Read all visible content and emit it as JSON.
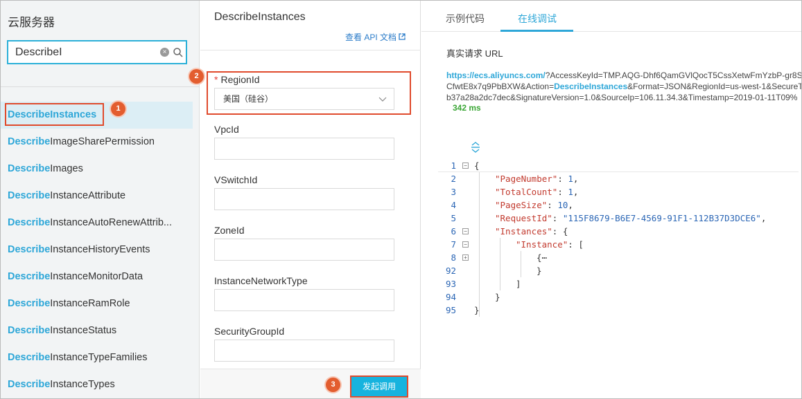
{
  "left": {
    "title": "云服务器",
    "search": {
      "value": "DescribeI",
      "placeholder": ""
    },
    "highlight_prefix": "Describe",
    "items": [
      {
        "prefix": "Describe",
        "rest": "Instances"
      },
      {
        "prefix": "Describe",
        "rest": "ImageSharePermission"
      },
      {
        "prefix": "Describe",
        "rest": "Images"
      },
      {
        "prefix": "Describe",
        "rest": "InstanceAttribute"
      },
      {
        "prefix": "Describe",
        "rest": "InstanceAutoRenewAttrib..."
      },
      {
        "prefix": "Describe",
        "rest": "InstanceHistoryEvents"
      },
      {
        "prefix": "Describe",
        "rest": "InstanceMonitorData"
      },
      {
        "prefix": "Describe",
        "rest": "InstanceRamRole"
      },
      {
        "prefix": "Describe",
        "rest": "InstanceStatus"
      },
      {
        "prefix": "Describe",
        "rest": "InstanceTypeFamilies"
      },
      {
        "prefix": "Describe",
        "rest": "InstanceTypes"
      }
    ]
  },
  "badges": {
    "one": "1",
    "two": "2",
    "three": "3"
  },
  "middle": {
    "title": "DescribeInstances",
    "api_doc_link": "查看 API 文档",
    "required_mark": "*",
    "fields": {
      "region": {
        "label": "RegionId",
        "value": "美国（硅谷）"
      },
      "vpc": {
        "label": "VpcId",
        "value": ""
      },
      "vswitch": {
        "label": "VSwitchId",
        "value": ""
      },
      "zone": {
        "label": "ZoneId",
        "value": ""
      },
      "network": {
        "label": "InstanceNetworkType",
        "value": ""
      },
      "secgroup": {
        "label": "SecurityGroupId",
        "value": ""
      }
    },
    "submit_label": "发起调用"
  },
  "right": {
    "tabs": [
      "示例代码",
      "在线调试"
    ],
    "active_tab": "在线调试",
    "url_label": "真实请求 URL",
    "url": {
      "line1_link": "https://ecs.aliyuncs.com/",
      "line1_rest": "?AccessKeyId=TMP.AQG-Dhf6QamGVlQocT5CssXetwFmYzbP-gr8S",
      "line2_pre": "CfwtE8x7q9PbBXW&Action=",
      "line2_api": "DescribeInstances",
      "line2_post": "&Format=JSON&RegionId=us-west-1&SecureT",
      "line3": "b37a28a2dc7dec&SignatureVersion=1.0&SourceIp=106.11.34.3&Timestamp=2019-01-11T09%"
    },
    "latency": "342 ms",
    "code_lines": [
      {
        "ln": "1",
        "fold": "−",
        "text": "{"
      },
      {
        "ln": "2",
        "fold": "",
        "key": "\"PageNumber\"",
        "sep": ": ",
        "val": "1",
        "tail": ","
      },
      {
        "ln": "3",
        "fold": "",
        "key": "\"TotalCount\"",
        "sep": ": ",
        "val": "1",
        "tail": ","
      },
      {
        "ln": "4",
        "fold": "",
        "key": "\"PageSize\"",
        "sep": ": ",
        "val": "10",
        "tail": ","
      },
      {
        "ln": "5",
        "fold": "",
        "key": "\"RequestId\"",
        "sep": ": ",
        "val": "\"115F8679-B6E7-4569-91F1-112B37D3DCE6\"",
        "tail": ","
      },
      {
        "ln": "6",
        "fold": "−",
        "key": "\"Instances\"",
        "sep": ": ",
        "val": "",
        "tail": "{"
      },
      {
        "ln": "7",
        "fold": "−",
        "key": "\"Instance\"",
        "sep": ": ",
        "val": "",
        "tail": "["
      },
      {
        "ln": "8",
        "fold": "+",
        "text": "{⋯"
      },
      {
        "ln": "92",
        "fold": "",
        "text": "}"
      },
      {
        "ln": "93",
        "fold": "",
        "text": "]"
      },
      {
        "ln": "94",
        "fold": "",
        "text": "}"
      },
      {
        "ln": "95",
        "fold": "",
        "text": "}"
      }
    ]
  },
  "colors": {
    "accent": "#2ea7d8",
    "annotation": "#e04a2c",
    "button": "#17b3de",
    "latency": "#3aa635"
  },
  "icons": {
    "search": "search-icon",
    "clear": "clear-icon",
    "external": "external-link-icon",
    "chevron": "chevron-down-icon",
    "collapse": "collapse-all-icon"
  }
}
